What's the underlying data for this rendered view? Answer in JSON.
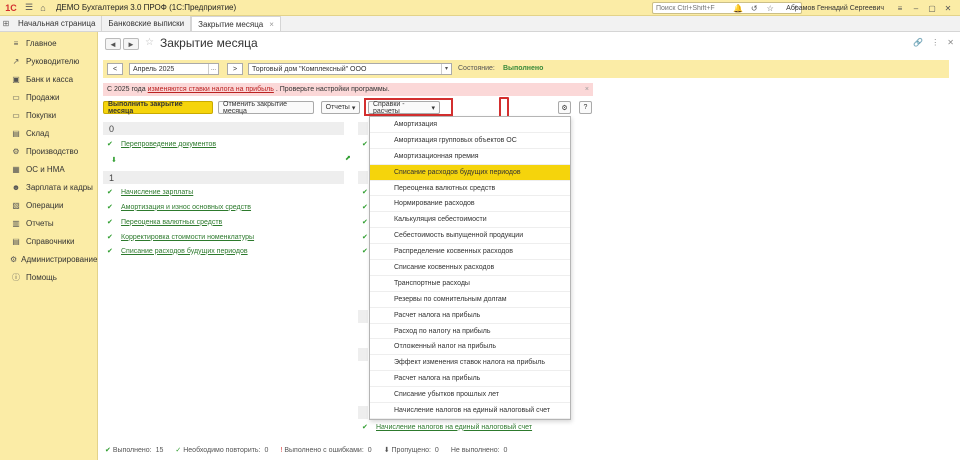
{
  "titlebar": {
    "logo": "1С",
    "title": "ДЕМО Бухгалтерия 3.0 ПРОФ  (1С:Предприятие)",
    "search_placeholder": "Поиск Ctrl+Shift+F",
    "user": "Абрамов Геннадий Сергеевич"
  },
  "tabs": [
    {
      "label": "Начальная страница"
    },
    {
      "label": "Банковские выписки"
    },
    {
      "label": "Закрытие месяца"
    }
  ],
  "sidebar": {
    "items": [
      {
        "label": "Главное",
        "icon": "≡"
      },
      {
        "label": "Руководителю",
        "icon": "↗"
      },
      {
        "label": "Банк и касса",
        "icon": "▣"
      },
      {
        "label": "Продажи",
        "icon": "▭"
      },
      {
        "label": "Покупки",
        "icon": "▭"
      },
      {
        "label": "Склад",
        "icon": "▤"
      },
      {
        "label": "Производство",
        "icon": "⚙"
      },
      {
        "label": "ОС и НМА",
        "icon": "▦"
      },
      {
        "label": "Зарплата и кадры",
        "icon": "☻"
      },
      {
        "label": "Операции",
        "icon": "▧"
      },
      {
        "label": "Отчеты",
        "icon": "▥"
      },
      {
        "label": "Справочники",
        "icon": "▤"
      },
      {
        "label": "Администрирование",
        "icon": "⚙"
      },
      {
        "label": "Помощь",
        "icon": "ⓘ"
      }
    ]
  },
  "page": {
    "title": "Закрытие месяца",
    "back": "◄",
    "forward": "►"
  },
  "params": {
    "prev": "<",
    "period": "Апрель 2025",
    "period_btn": "...",
    "next": ">",
    "org": "Торговый дом \"Комплексный\" ООО",
    "state_label": "Состояние:",
    "state_value": "Выполнено"
  },
  "warning": {
    "before": "С 2025 года",
    "link": "изменяются ставки налога на прибыль",
    "after": ". Проверьте настройки программы."
  },
  "actions": {
    "execute": "Выполнить закрытие месяца",
    "cancel": "Отменить закрытие месяца",
    "reports": "Отчеты",
    "calcs": "Справки - расчеты",
    "settings_icon": "⚙",
    "help": "?"
  },
  "left_column": {
    "stage0": "0",
    "stage0_ops": [
      "Перепроведение документов"
    ],
    "stage1": "1",
    "stage1_ops": [
      "Начисление зарплаты",
      "Амортизация и износ основных средств",
      "Переоценка валютных средств",
      "Корректировка стоимости номенклатуры",
      "Списание расходов будущих периодов"
    ]
  },
  "right_column": {
    "bottom_op": "Начисление налогов на единый налоговый счет"
  },
  "dropdown": {
    "items": [
      "Амортизация",
      "Амортизация групповых объектов ОС",
      "Амортизационная премия",
      "Списание расходов будущих периодов",
      "Переоценка валютных средств",
      "Нормирование расходов",
      "Калькуляция себестоимости",
      "Себестоимость выпущенной продукции",
      "Распределение косвенных расходов",
      "Списание косвенных расходов",
      "Транспортные расходы",
      "Резервы по сомнительным долгам",
      "Расчет налога на прибыль",
      "Расход по налогу на прибыль",
      "Отложенный налог на прибыль",
      "Эффект изменения ставок налога на прибыль",
      "Расчет налога на прибыль",
      "Списание убытков прошлых лет",
      "Начисление налогов на единый налоговый счет"
    ],
    "highlighted_index": 3
  },
  "statusbar": {
    "done_label": "Выполнено:",
    "done_value": "15",
    "repeat_label": "Необходимо повторить:",
    "repeat_value": "0",
    "errors_label": "Выполнено с ошибками:",
    "errors_value": "0",
    "skipped_label": "Пропущено:",
    "skipped_value": "0",
    "notdone_label": "Не выполнено:",
    "notdone_value": "0"
  }
}
